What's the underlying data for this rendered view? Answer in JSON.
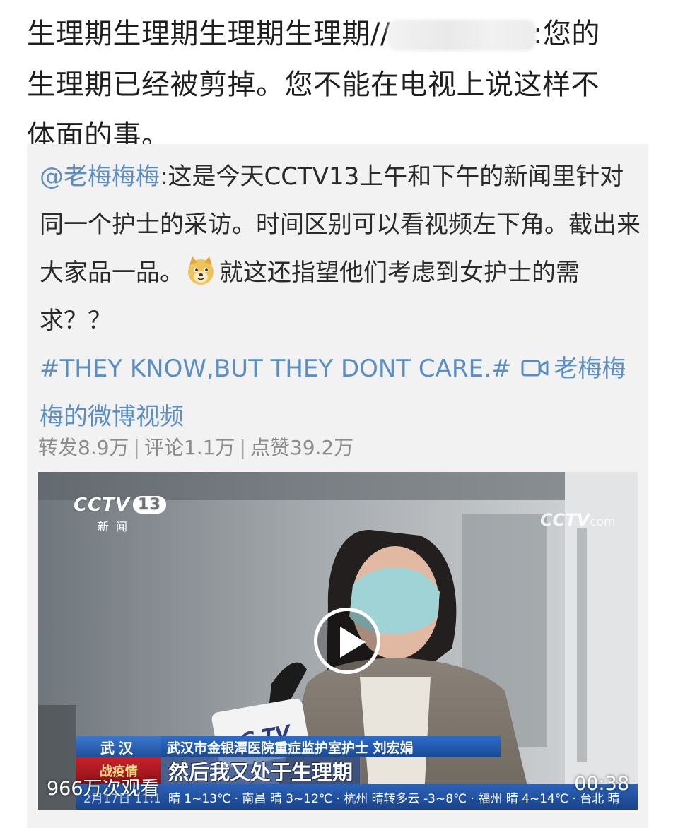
{
  "post": {
    "line1_a": "生理期生理期生理期生理期//",
    "line1_b": ":您的",
    "line2": "生理期已经被剪掉。您不能在电视上说这样不",
    "line3": "体面的事。"
  },
  "repost": {
    "mention": "@老梅梅梅",
    "text_a": ":这是今天CCTV13上午和下午的新闻里针对同一个护士的采访。时间区别可以看视频左下角。截出来大家品一品。",
    "emoji": "doge-emoji",
    "text_b": "就这还指望他们考虑到女护士的需求？？",
    "hashtag": "#THEY KNOW,BUT THEY DONT CARE.#",
    "video_link": "老梅梅梅的微博视频",
    "stats": {
      "reposts": "转发8.9万",
      "comments": "评论1.1万",
      "likes": "点赞39.2万",
      "separator": "|"
    }
  },
  "video": {
    "channel_logo": "CCTV",
    "channel_num": "13",
    "channel_sub": "新闻",
    "watermark": "CCTV",
    "watermark_suffix": "com",
    "city": "武汉",
    "caption": "武汉市金银潭医院重症监护室护士 刘宏娟",
    "tag": "战疫情",
    "subtitle": "然后我又处于生理期",
    "ticker_date": "2月17日 11:1",
    "ticker": "晴 1~13℃ · 南昌 晴 3~12℃ · 杭州 晴转多云 -3~8℃ · 福州 晴 4~14℃ · 台北 晴",
    "views": "966万次观看",
    "duration": "00:38"
  },
  "colors": {
    "link": "#5b8fc4",
    "repost_bg": "#f2f2f2",
    "stats": "#8c8c8c"
  }
}
